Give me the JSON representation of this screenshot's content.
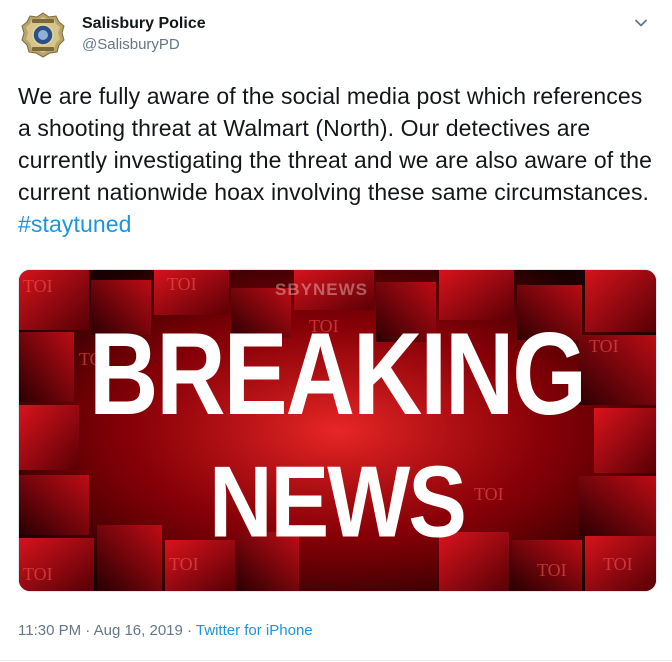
{
  "tweet": {
    "display_name": "Salisbury Police",
    "handle": "@SalisburyPD",
    "text_body": "We are fully aware of the social media post which references a shooting threat at Walmart (North). Our detectives are currently investigating the threat and we are also aware of the current nationwide hoax involving these same circumstances.",
    "hashtag": "#staytuned",
    "time": "11:30 PM",
    "date": "Aug 16, 2019",
    "source": "Twitter for iPhone"
  },
  "media": {
    "watermark": "SBYNEWS",
    "headline_line1": "BREAKING",
    "headline_line2": "NEWS",
    "block_label": "TOI"
  },
  "colors": {
    "link": "#1b95e0",
    "secondary_text": "#657786",
    "primary_text": "#14171a",
    "media_red": "#c8101a"
  },
  "icons": {
    "avatar": "police-badge-icon",
    "menu": "chevron-down-icon"
  }
}
